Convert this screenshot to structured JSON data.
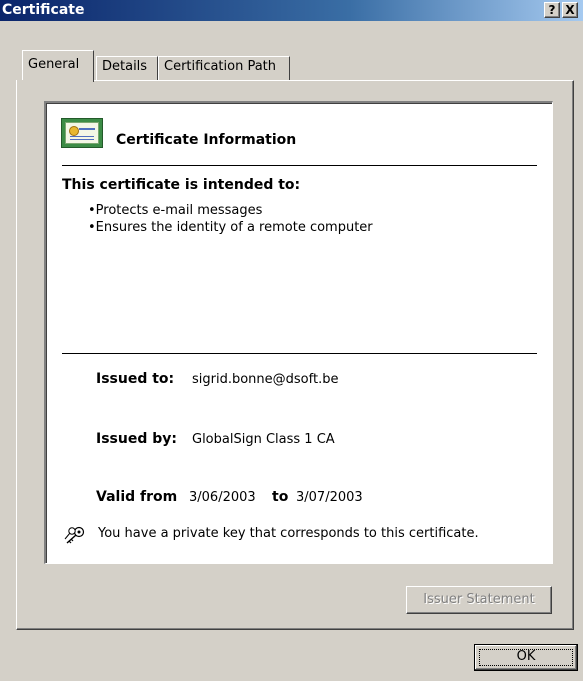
{
  "window": {
    "title": "Certificate",
    "help_button": "?",
    "close_button": "X"
  },
  "tabs": [
    {
      "label": "General",
      "active": true
    },
    {
      "label": "Details",
      "active": false
    },
    {
      "label": "Certification Path",
      "active": false
    }
  ],
  "general": {
    "heading": "Certificate Information",
    "intended_label": "This certificate is intended to:",
    "purposes": [
      "•Protects e-mail messages",
      "•Ensures the identity of a remote computer"
    ],
    "issued_to_label": "Issued to:",
    "issued_to": "sigrid.bonne@dsoft.be",
    "issued_by_label": "Issued by:",
    "issued_by": "GlobalSign Class 1 CA",
    "valid_from_label": "Valid from",
    "valid_from": "3/06/2003",
    "to_label": "to",
    "valid_to": "3/07/2003",
    "private_key_note": "You have a private key that corresponds to this certificate."
  },
  "buttons": {
    "issuer_statement": "Issuer Statement",
    "ok": "OK"
  },
  "icons": {
    "certificate": "certificate-icon",
    "key": "key-icon"
  },
  "colors": {
    "title_bar": "#0a246a",
    "face": "#d4d0c8",
    "disabled_text": "#808080"
  }
}
